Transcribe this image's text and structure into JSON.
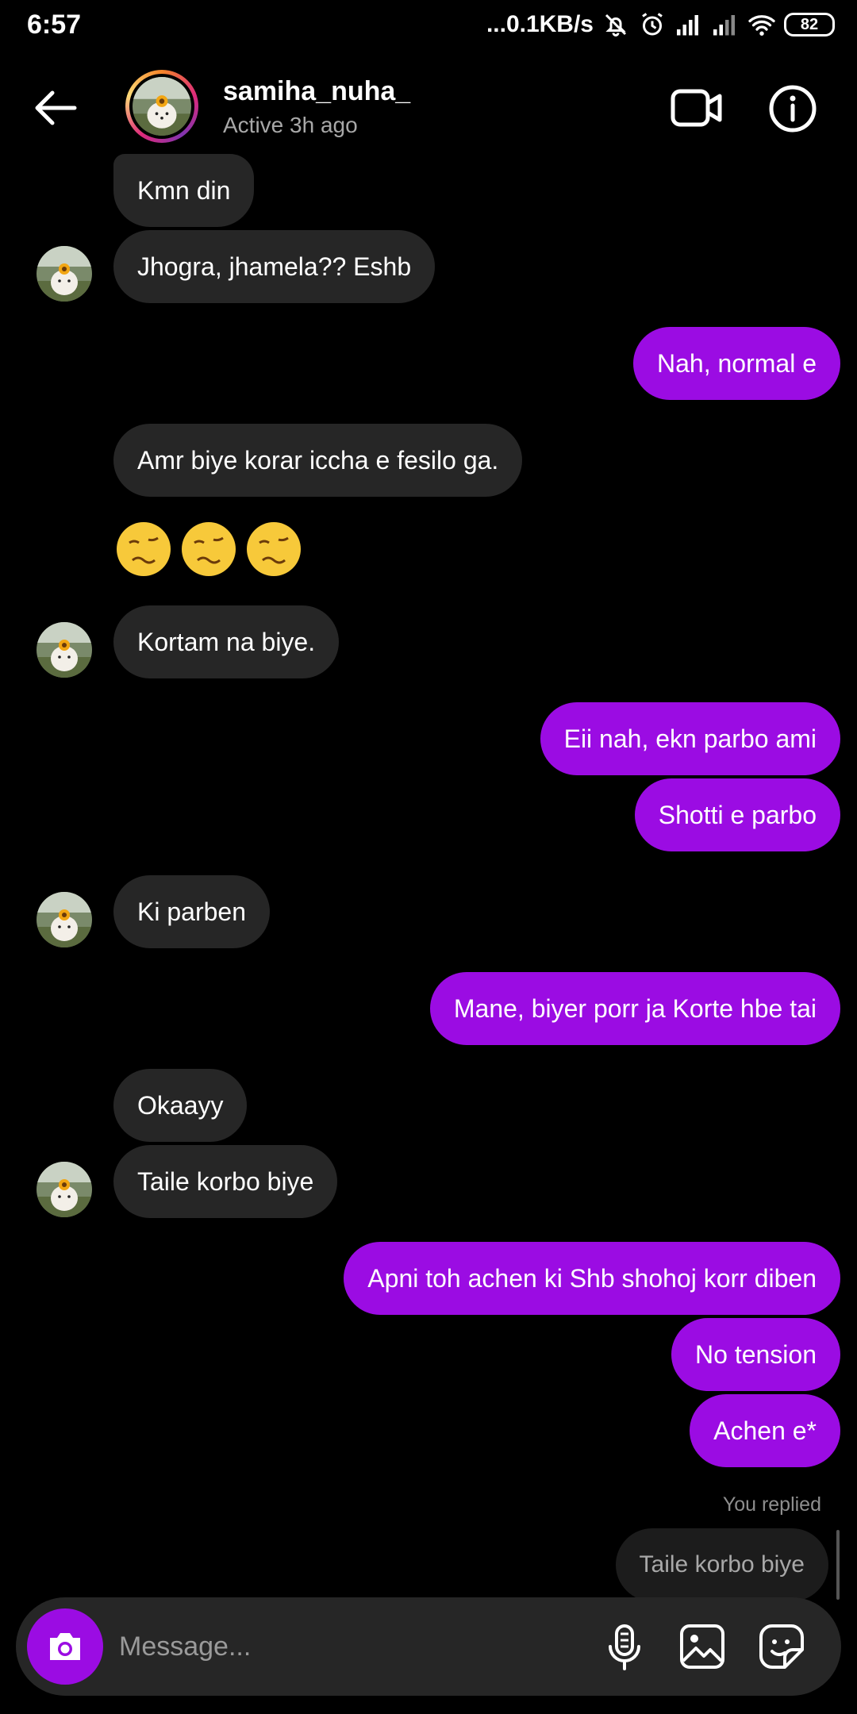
{
  "status_bar": {
    "time": "6:57",
    "speed": "...0.1KB/s",
    "battery": "82"
  },
  "header": {
    "username": "samiha_nuha_",
    "active_status": "Active 3h ago"
  },
  "messages": [
    {
      "dir": "in",
      "text": "Kmn din"
    },
    {
      "dir": "in",
      "text": "Jhogra, jhamela?? Eshb"
    },
    {
      "dir": "out",
      "text": "Nah, normal e"
    },
    {
      "dir": "in",
      "text": "Amr biye korar iccha e fesilo ga."
    },
    {
      "dir": "in",
      "text": "Kortam na biye."
    },
    {
      "dir": "out",
      "text": "Eii nah, ekn parbo ami"
    },
    {
      "dir": "out",
      "text": "Shotti e parbo"
    },
    {
      "dir": "in",
      "text": "Ki parben"
    },
    {
      "dir": "out",
      "text": "Mane, biyer porr ja Korte hbe tai"
    },
    {
      "dir": "in",
      "text": "Okaayy"
    },
    {
      "dir": "in",
      "text": "Taile korbo biye"
    },
    {
      "dir": "out",
      "text": "Apni toh achen ki Shb shohoj korr diben"
    },
    {
      "dir": "out",
      "text": "No tension"
    },
    {
      "dir": "out",
      "text": "Achen e*"
    }
  ],
  "emoji_message": [
    "woozy-face",
    "woozy-face",
    "woozy-face"
  ],
  "reply": {
    "label": "You replied",
    "quoted_text": "Taile korbo biye"
  },
  "composer": {
    "placeholder": "Message..."
  },
  "colors": {
    "outgoing_bubble": "#9b0ce3",
    "incoming_bubble": "#262626",
    "background": "#000000"
  }
}
